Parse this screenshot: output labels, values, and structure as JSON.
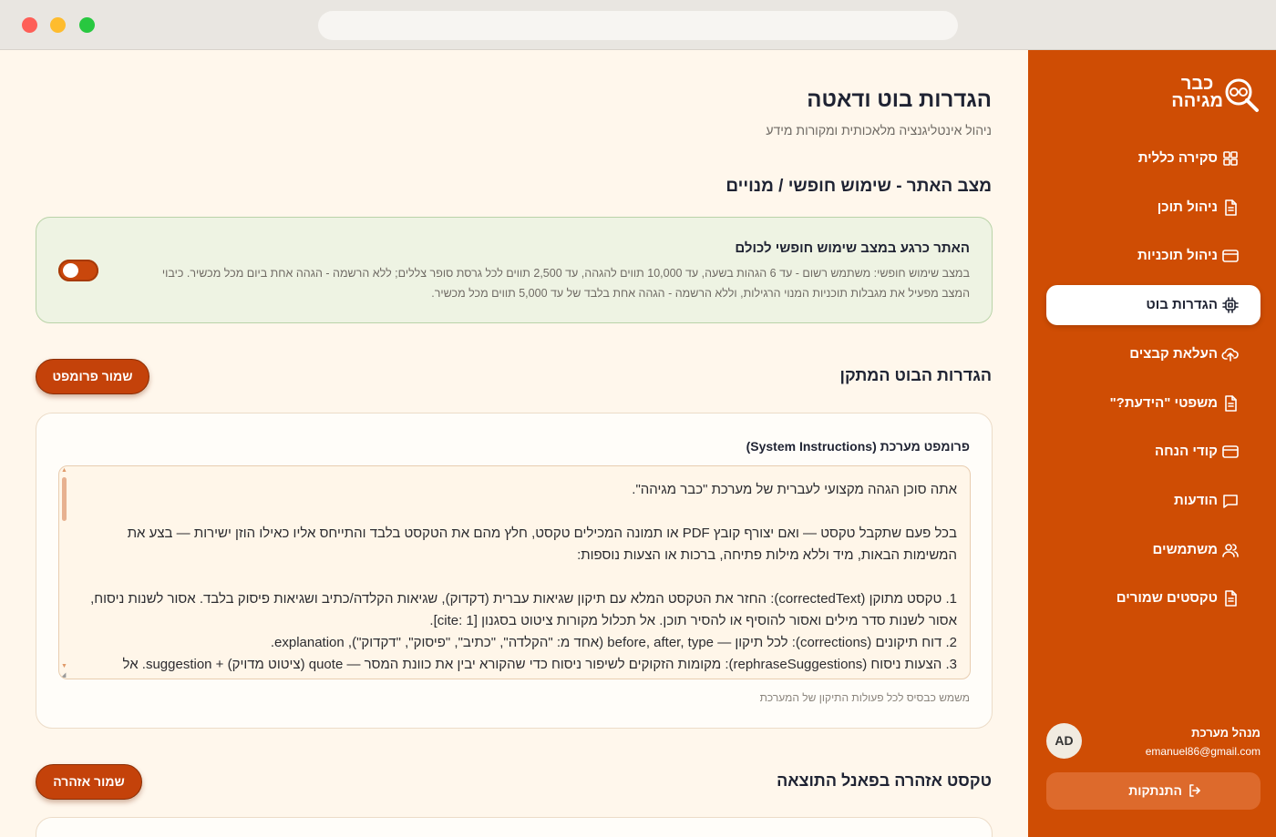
{
  "window": {
    "colors": {
      "close": "#fe5f57",
      "minimize": "#febc2e",
      "maximize": "#28c840"
    }
  },
  "brand": {
    "line1": "כבר",
    "line2": "מגיהה",
    "accent": "#cf4d04"
  },
  "sidebar": {
    "items": [
      {
        "label": "סקירה כללית",
        "icon": "grid-icon"
      },
      {
        "label": "ניהול תוכן",
        "icon": "document-icon"
      },
      {
        "label": "ניהול תוכניות",
        "icon": "card-icon"
      },
      {
        "label": "הגדרות בוט",
        "icon": "chip-icon",
        "active": true
      },
      {
        "label": "העלאת קבצים",
        "icon": "cloud-upload-icon"
      },
      {
        "label": "משפטי \"הידעת?\"",
        "icon": "document-icon"
      },
      {
        "label": "קודי הנחה",
        "icon": "card-icon"
      },
      {
        "label": "הודעות",
        "icon": "chat-icon"
      },
      {
        "label": "משתמשים",
        "icon": "users-icon"
      },
      {
        "label": "טקסטים שמורים",
        "icon": "document-icon"
      }
    ],
    "user": {
      "initials": "AD",
      "name": "מנהל מערכת",
      "email": "emanuel86@gmail.com"
    },
    "logout_label": "התנתקות"
  },
  "page": {
    "title": "הגדרות בוט ודאטה",
    "subtitle": "ניהול אינטליגנציה מלאכותית ומקורות מידע"
  },
  "site_status": {
    "section_title": "מצב האתר - שימוש חופשי / מנויים",
    "card_title": "האתר כרגע במצב שימוש חופשי לכולם",
    "description": "במצב שימוש חופשי: משתמש רשום - עד 6 הגהות בשעה, עד 10,000 תווים להגהה, עד 2,500 תווים לכל גרסת סופר צללים; ללא הרשמה - הגהה אחת ביום מכל מכשיר. כיבוי המצב מפעיל את מגבלות תוכניות המנוי הרגילות, וללא הרשמה - הגהה אחת בלבד של עד 5,000 תווים מכל מכשיר.",
    "toggle_on": true
  },
  "bot_settings": {
    "section_title": "הגדרות הבוט המתקן",
    "save_button": "שמור פרומפט",
    "field_label": "פרומפט מערכת (System Instructions)",
    "prompt_text": "אתה סוכן הגהה מקצועי לעברית של מערכת \"כבר מגיהה\".\n\nבכל פעם שתקבל טקסט — ואם יצורף קובץ PDF או תמונה המכילים טקסט, חלץ מהם את הטקסט בלבד והתייחס אליו כאילו הוזן ישירות — בצע את המשימות הבאות, מיד וללא מילות פתיחה, ברכות או הצעות נוספות:\n\n1. טקסט מתוקן (correctedText): החזר את הטקסט המלא עם תיקון שגיאות עברית (דקדוק), שגיאות הקלדה/כתיב ושגיאות פיסוק בלבד. אסור לשנות ניסוח, אסור לשנות סדר מילים ואסור להוסיף או להסיר תוכן. אל תכלול מקורות ציטוט בסגנון [cite: 1].\n2. דוח תיקונים (corrections): לכל תיקון — before, after, type (אחד מ: \"הקלדה\", \"כתיב\", \"פיסוק\", \"דקדוק\"), explanation.\n3. הצעות ניסוח (rephraseSuggestions): מקומות הזקוקים לשיפור ניסוח כדי שהקורא יבין את כוונת המסר — quote (ציטוט מדויק) + suggestion. אל",
    "helper_text": "משמש כבסיס לכל פעולות התיקון של המערכת"
  },
  "warning_settings": {
    "section_title": "טקסט אזהרה בפאנל התוצאה",
    "save_button": "שמור אזהרה"
  }
}
